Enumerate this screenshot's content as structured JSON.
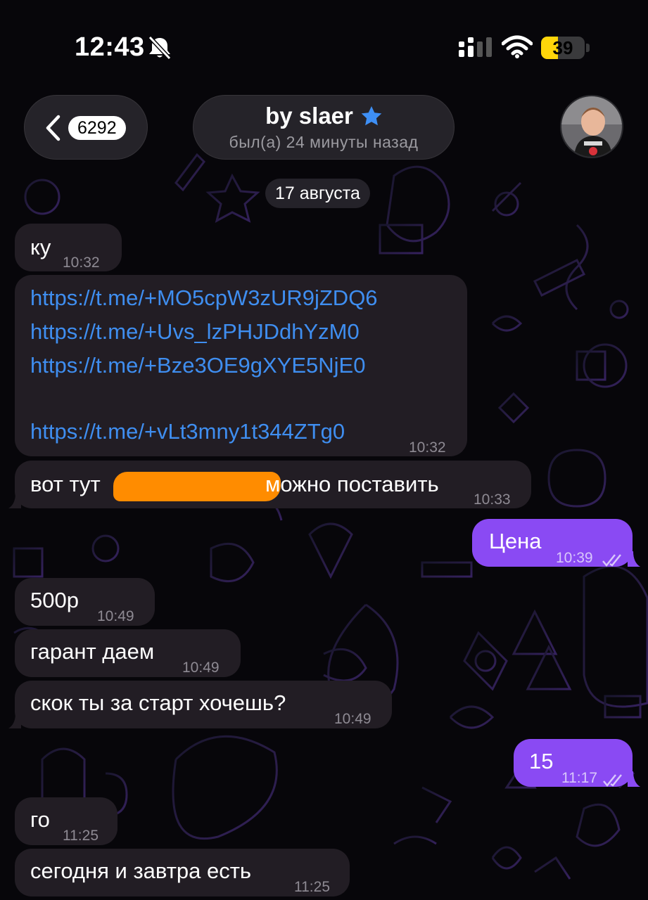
{
  "status_bar": {
    "time": "12:43",
    "battery": "39",
    "battery_level": 0.39,
    "accent": "#ffd60a"
  },
  "header": {
    "back_count": "6292",
    "title": "by slaer",
    "status": "был(а) 24 минуты назад",
    "verified_icon": "star-icon",
    "star_color": "#3e8ff5"
  },
  "date_separator": "17 августа",
  "messages": [
    {
      "dir": "in",
      "text": "ку",
      "time": "10:32"
    },
    {
      "dir": "in",
      "links": [
        "https://t.me/+MO5cpW3zUR9jZDQ6",
        "https://t.me/+Uvs_lzPHJDdhYzM0",
        "https://t.me/+Bze3OE9gXYE5NjE0",
        "https://t.me/+vLt3mny1t344ZTg0"
      ],
      "time": "10:32"
    },
    {
      "dir": "in",
      "text_before": "вот тут",
      "text_after": "можно поставить",
      "time": "10:33",
      "redacted": true
    },
    {
      "dir": "out",
      "text": "Цена",
      "time": "10:39",
      "read": true
    },
    {
      "dir": "in",
      "text": "500р",
      "time": "10:49"
    },
    {
      "dir": "in",
      "text": "гарант даем",
      "time": "10:49"
    },
    {
      "dir": "in",
      "text": "скок ты за старт хочешь?",
      "time": "10:49"
    },
    {
      "dir": "out",
      "text": "15",
      "time": "11:17",
      "read": true
    },
    {
      "dir": "in",
      "text": "го",
      "time": "11:25"
    },
    {
      "dir": "in",
      "text": "сегодня и завтра есть",
      "time": "11:25"
    }
  ],
  "colors": {
    "incoming_bubble": "#221d24",
    "outgoing_bubble": "#8a4af3",
    "link": "#3f8ef0",
    "redaction": "#ff8c00"
  }
}
